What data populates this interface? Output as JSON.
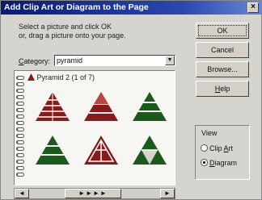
{
  "window": {
    "title": "Add Clip Art or Diagram to the Page",
    "close_label": "×"
  },
  "instructions": {
    "line1": "Select a picture and click OK",
    "line2": "or, drag a picture onto your page."
  },
  "category": {
    "label_prefix": "",
    "label_underlined": "C",
    "label_rest": "ategory:",
    "value": "pyramid"
  },
  "buttons": {
    "ok": "OK",
    "cancel": "Cancel",
    "browse": "Browse...",
    "help_underlined": "H",
    "help_rest": "elp"
  },
  "gallery": {
    "title": "Pyramid 2 (1 of 7)",
    "thumbnails": [
      {
        "name": "pyramid-thumb-1",
        "color": "#8a1a1a"
      },
      {
        "name": "pyramid-thumb-2",
        "color": "#8a1a1a"
      },
      {
        "name": "pyramid-thumb-3",
        "color": "#1c5a1c"
      },
      {
        "name": "pyramid-thumb-4",
        "color": "#1c5a1c"
      },
      {
        "name": "pyramid-thumb-5",
        "color": "#8a1a1a"
      },
      {
        "name": "pyramid-thumb-6",
        "color": "#1c5a1c"
      }
    ]
  },
  "view": {
    "label": "View",
    "options": [
      {
        "label_pre": "Clip ",
        "underlined": "A",
        "label_post": "rt",
        "selected": false
      },
      {
        "label_pre": "",
        "underlined": "D",
        "label_post": "iagram",
        "selected": true
      }
    ]
  },
  "scrollbar": {
    "left_arrow": "◄",
    "right_arrow": "►",
    "thumb": "►►►►"
  }
}
